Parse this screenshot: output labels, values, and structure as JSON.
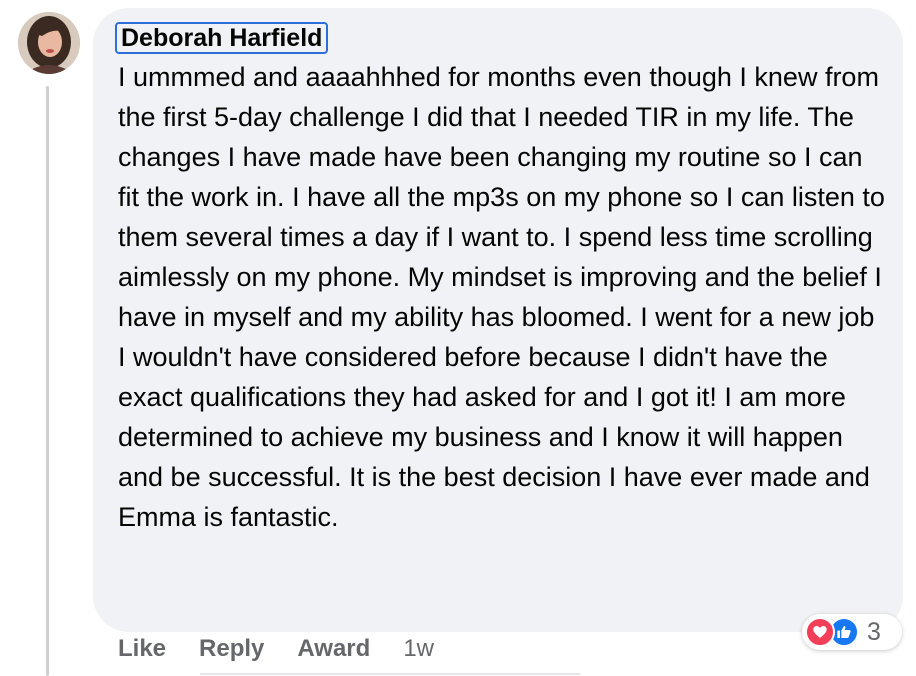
{
  "comment": {
    "author": "Deborah Harfield",
    "text": "I ummmed and aaaahhhed for months even though I knew from the first 5-day challenge I did that I needed TIR in my life. The changes I have made have been changing my routine so I can fit the work in. I have all the mp3s on my phone so I can listen to them several times a day if I want to. I spend less time scrolling aimlessly on my phone. My mindset is improving and the belief I have in myself and my ability has bloomed. I went for a new job I wouldn't have considered before because I didn't have the exact qualifications they had asked for and I got it! I am more determined to achieve my business and I know it will happen and be successful. It is the best decision I have ever made and Emma is fantastic."
  },
  "actions": {
    "like": "Like",
    "reply": "Reply",
    "award": "Award",
    "time": "1w"
  },
  "reactions": {
    "icons": [
      "love-icon",
      "like-icon"
    ],
    "count": "3"
  },
  "colors": {
    "bubble": "#f0f2f5",
    "focus_outline": "#2d6fd8",
    "love": "#f33e58",
    "like": "#1877f2",
    "secondary_text": "#65676b"
  }
}
